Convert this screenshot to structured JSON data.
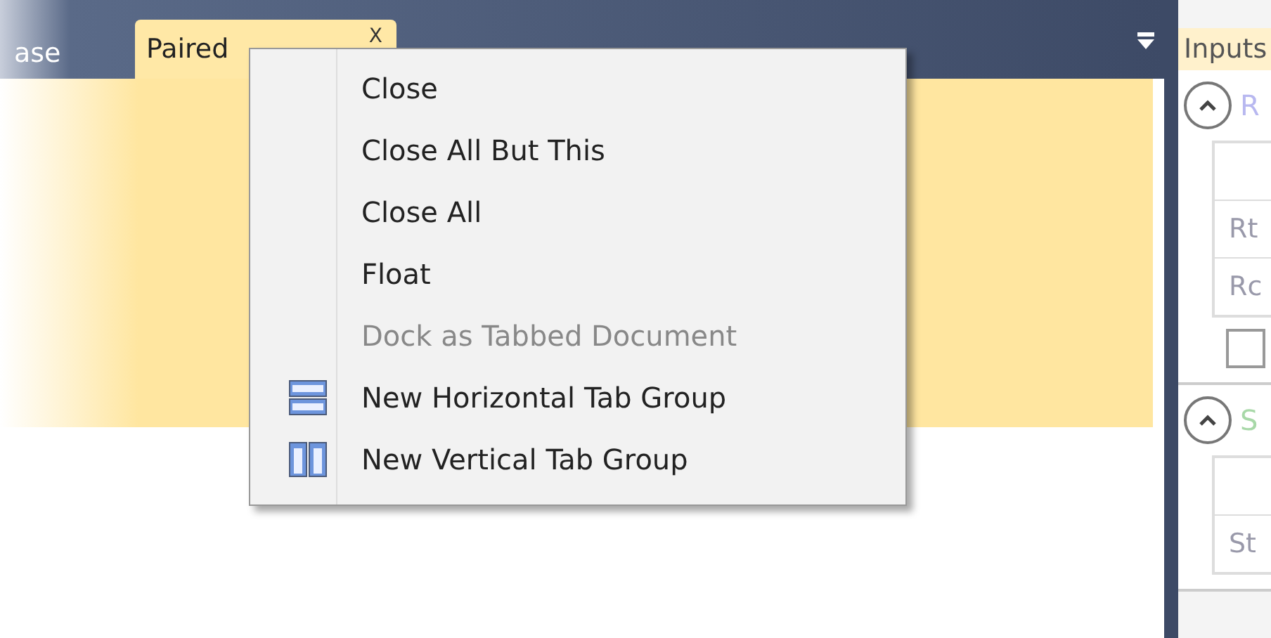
{
  "document_tabs": [
    {
      "label": "ase",
      "selected": false
    },
    {
      "label": "Paired",
      "selected": true
    }
  ],
  "tab_close": "X",
  "context_menu": {
    "items": [
      {
        "label": "Close",
        "disabled": false,
        "kind": "plain"
      },
      {
        "label": "Close All But This",
        "disabled": false,
        "kind": "plain"
      },
      {
        "label": "Close All",
        "disabled": false,
        "kind": "plain"
      },
      {
        "label": "Float",
        "disabled": false,
        "kind": "plain"
      },
      {
        "label": "Dock as Tabbed Document",
        "disabled": true,
        "kind": "plain"
      },
      {
        "label": "New Horizontal Tab Group",
        "disabled": false,
        "kind": "horizontal"
      },
      {
        "label": "New Vertical Tab Group",
        "disabled": false,
        "kind": "vertical"
      }
    ]
  },
  "side_panel": {
    "tab": "Inputs",
    "groups": [
      {
        "title": "R",
        "color": "#b8b8f0",
        "expanded": true,
        "rows": [
          "Rt",
          "Rc"
        ],
        "checkbox": {
          "checked": false
        }
      },
      {
        "title": "S",
        "color": "#a8d8a8",
        "expanded": true,
        "rows": [
          "St"
        ]
      }
    ]
  }
}
